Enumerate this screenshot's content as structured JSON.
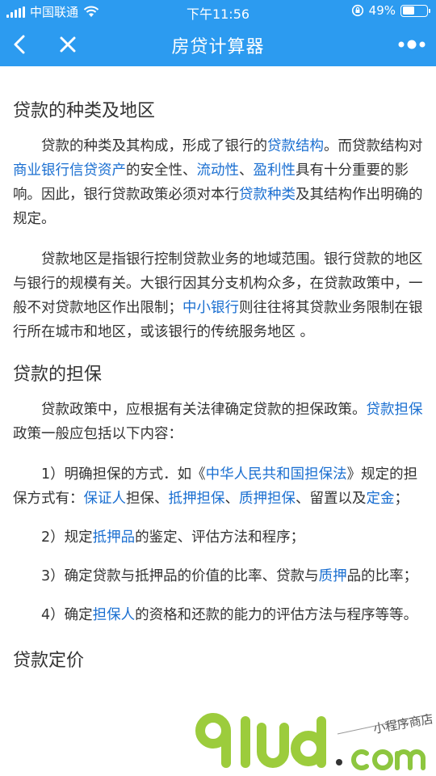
{
  "status": {
    "carrier": "中国联通",
    "time": "下午11:56",
    "battery_pct": "49%",
    "battery_level": 0.49
  },
  "nav": {
    "title": "房贷计算器"
  },
  "sections": [
    {
      "title": "贷款的种类及地区",
      "paragraphs": [
        [
          {
            "t": "贷款的种类及其构成，形成了银行的"
          },
          {
            "t": "贷款结构",
            "link": true
          },
          {
            "t": "。而贷款结构对"
          },
          {
            "t": "商业银行信贷资产",
            "link": true
          },
          {
            "t": "的安全性、"
          },
          {
            "t": "流动性",
            "link": true
          },
          {
            "t": "、"
          },
          {
            "t": "盈利性",
            "link": true
          },
          {
            "t": "具有十分重要的影响。因此，银行贷款政策必须对本行"
          },
          {
            "t": "贷款种类",
            "link": true
          },
          {
            "t": "及其结构作出明确的规定。"
          }
        ],
        [
          {
            "t": "贷款地区是指银行控制贷款业务的地域范围。银行贷款的地区与银行的规模有关。大银行因其分支机构众多，在贷款政策中，一般不对贷款地区作出限制；"
          },
          {
            "t": "中小银行",
            "link": true
          },
          {
            "t": "则往往将其贷款业务限制在银行所在城市和地区，或该银行的传统服务地区 。"
          }
        ]
      ]
    },
    {
      "title": "贷款的担保",
      "paragraphs": [
        [
          {
            "t": "贷款政策中，应根据有关法律确定贷款的担保政策。"
          },
          {
            "t": "贷款担保",
            "link": true
          },
          {
            "t": "政策一般应包括以下内容："
          }
        ],
        [
          {
            "t": "1）明确担保的方式．如《"
          },
          {
            "t": "中华人民共和国担保法",
            "link": true
          },
          {
            "t": "》规定的担保方式有："
          },
          {
            "t": "保证人",
            "link": true
          },
          {
            "t": "担保、"
          },
          {
            "t": "抵押担保",
            "link": true
          },
          {
            "t": "、"
          },
          {
            "t": "质押担保",
            "link": true
          },
          {
            "t": "、留置以及"
          },
          {
            "t": "定金",
            "link": true
          },
          {
            "t": "；"
          }
        ],
        [
          {
            "t": "2）规定"
          },
          {
            "t": "抵押品",
            "link": true
          },
          {
            "t": "的鉴定、评估方法和程序；"
          }
        ],
        [
          {
            "t": "3）确定贷款与抵押品的价值的比率、贷款与"
          },
          {
            "t": "质押",
            "link": true
          },
          {
            "t": "品的比率；"
          }
        ],
        [
          {
            "t": "4）确定"
          },
          {
            "t": "担保人",
            "link": true
          },
          {
            "t": "的资格和还款的能力的评估方法与程序等等。"
          }
        ]
      ]
    },
    {
      "title": "贷款定价",
      "paragraphs": []
    }
  ],
  "watermark": {
    "brand": "91ud",
    "suffix": ".com",
    "tagline": "小程序商店"
  }
}
